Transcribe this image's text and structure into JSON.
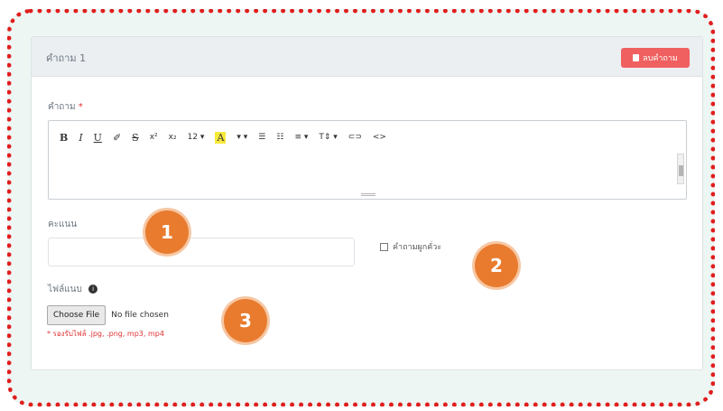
{
  "panel": {
    "title": "คำถาม 1",
    "delete_label": "ลบคำถาม"
  },
  "question_field": {
    "label": "คำถาม",
    "required_mark": "*"
  },
  "toolbar": {
    "bold": "B",
    "italic": "I",
    "underline": "U",
    "eraser": "✐",
    "strike": "S",
    "superscript": "x²",
    "subscript": "x₂",
    "font_size": "12 ▾",
    "highlight": "A",
    "highlight_more": "▾ ▾",
    "unordered_list": "☰",
    "ordered_list": "☷",
    "align": "≡ ▾",
    "text_size": "T⇕ ▾",
    "link": "⊂⊃",
    "code": "<>"
  },
  "answer_field": {
    "label": "คะแนน",
    "value": "",
    "checkbox_label": "คำถามผูกคั่วะ",
    "checked": false
  },
  "file_field": {
    "label": "ไฟล์แนบ",
    "button_label": "Choose File",
    "status": "No file chosen",
    "hint": "* รองรับไฟล์ .jpg, .png, mp3, mp4"
  },
  "badges": [
    "1",
    "2",
    "3"
  ],
  "colors": {
    "accent_orange": "#e97b2e",
    "danger_red": "#f06060",
    "dotted_border": "#e01e1e"
  }
}
